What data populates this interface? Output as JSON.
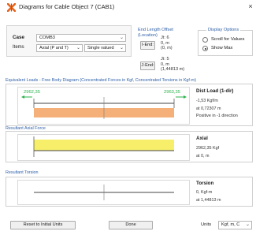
{
  "window": {
    "title": "Diagrams for Cable Object 7 (CAB1)",
    "close_glyph": "×"
  },
  "selection": {
    "case_label": "Case",
    "case_value": "COMB3",
    "items_label": "Items",
    "items_value": "Axial (P and T)",
    "mode_value": "Single valued"
  },
  "end_length_offset": {
    "title": "End Length Offset (Location)",
    "i_end_button": "I-End:",
    "i_end_values": [
      "Jt: 6",
      "0, m",
      "(0, m)"
    ],
    "j_end_button": "J-End:",
    "j_end_values": [
      "Jt: 5",
      "0, m",
      "(1,44813 m)"
    ]
  },
  "display_options": {
    "title": "Display Options",
    "options": [
      {
        "label": "Scroll for Values",
        "selected": false
      },
      {
        "label": "Show Max",
        "selected": true
      }
    ]
  },
  "equivalent_loads": {
    "title": "Equivalent Loads - Free Body Diagram  (Concentrated Forces in Kgf, Concentrated Torsions in Kgf-m)",
    "left_force": "2962,35",
    "right_force": "2963,35",
    "side_title": "Dist Load (1-dir)",
    "side_values": [
      "-1,53 Kgf/m",
      "at 0,72307 m",
      "Positive in -1 direction"
    ]
  },
  "resultant_axial": {
    "title": "Resultant Axial Force",
    "side_title": "Axial",
    "side_values": [
      "2962,35 Kgf",
      "at 0, m"
    ]
  },
  "resultant_torsion": {
    "title": "Resultant Torsion",
    "side_title": "Torsion",
    "side_values": [
      "0, Kgf-m",
      "at 1,44813 m"
    ]
  },
  "footer": {
    "reset_button": "Reset to Initial Units",
    "done_button": "Done",
    "units_label": "Units",
    "units_value": "Kgf, m, C"
  },
  "colors": {
    "load_fill": "#f5b079",
    "axial_fill": "#f7ef6a",
    "force_arrow": "#2bb24c",
    "accent_text": "#2d5fa8",
    "app_icon": "#e8631a"
  }
}
